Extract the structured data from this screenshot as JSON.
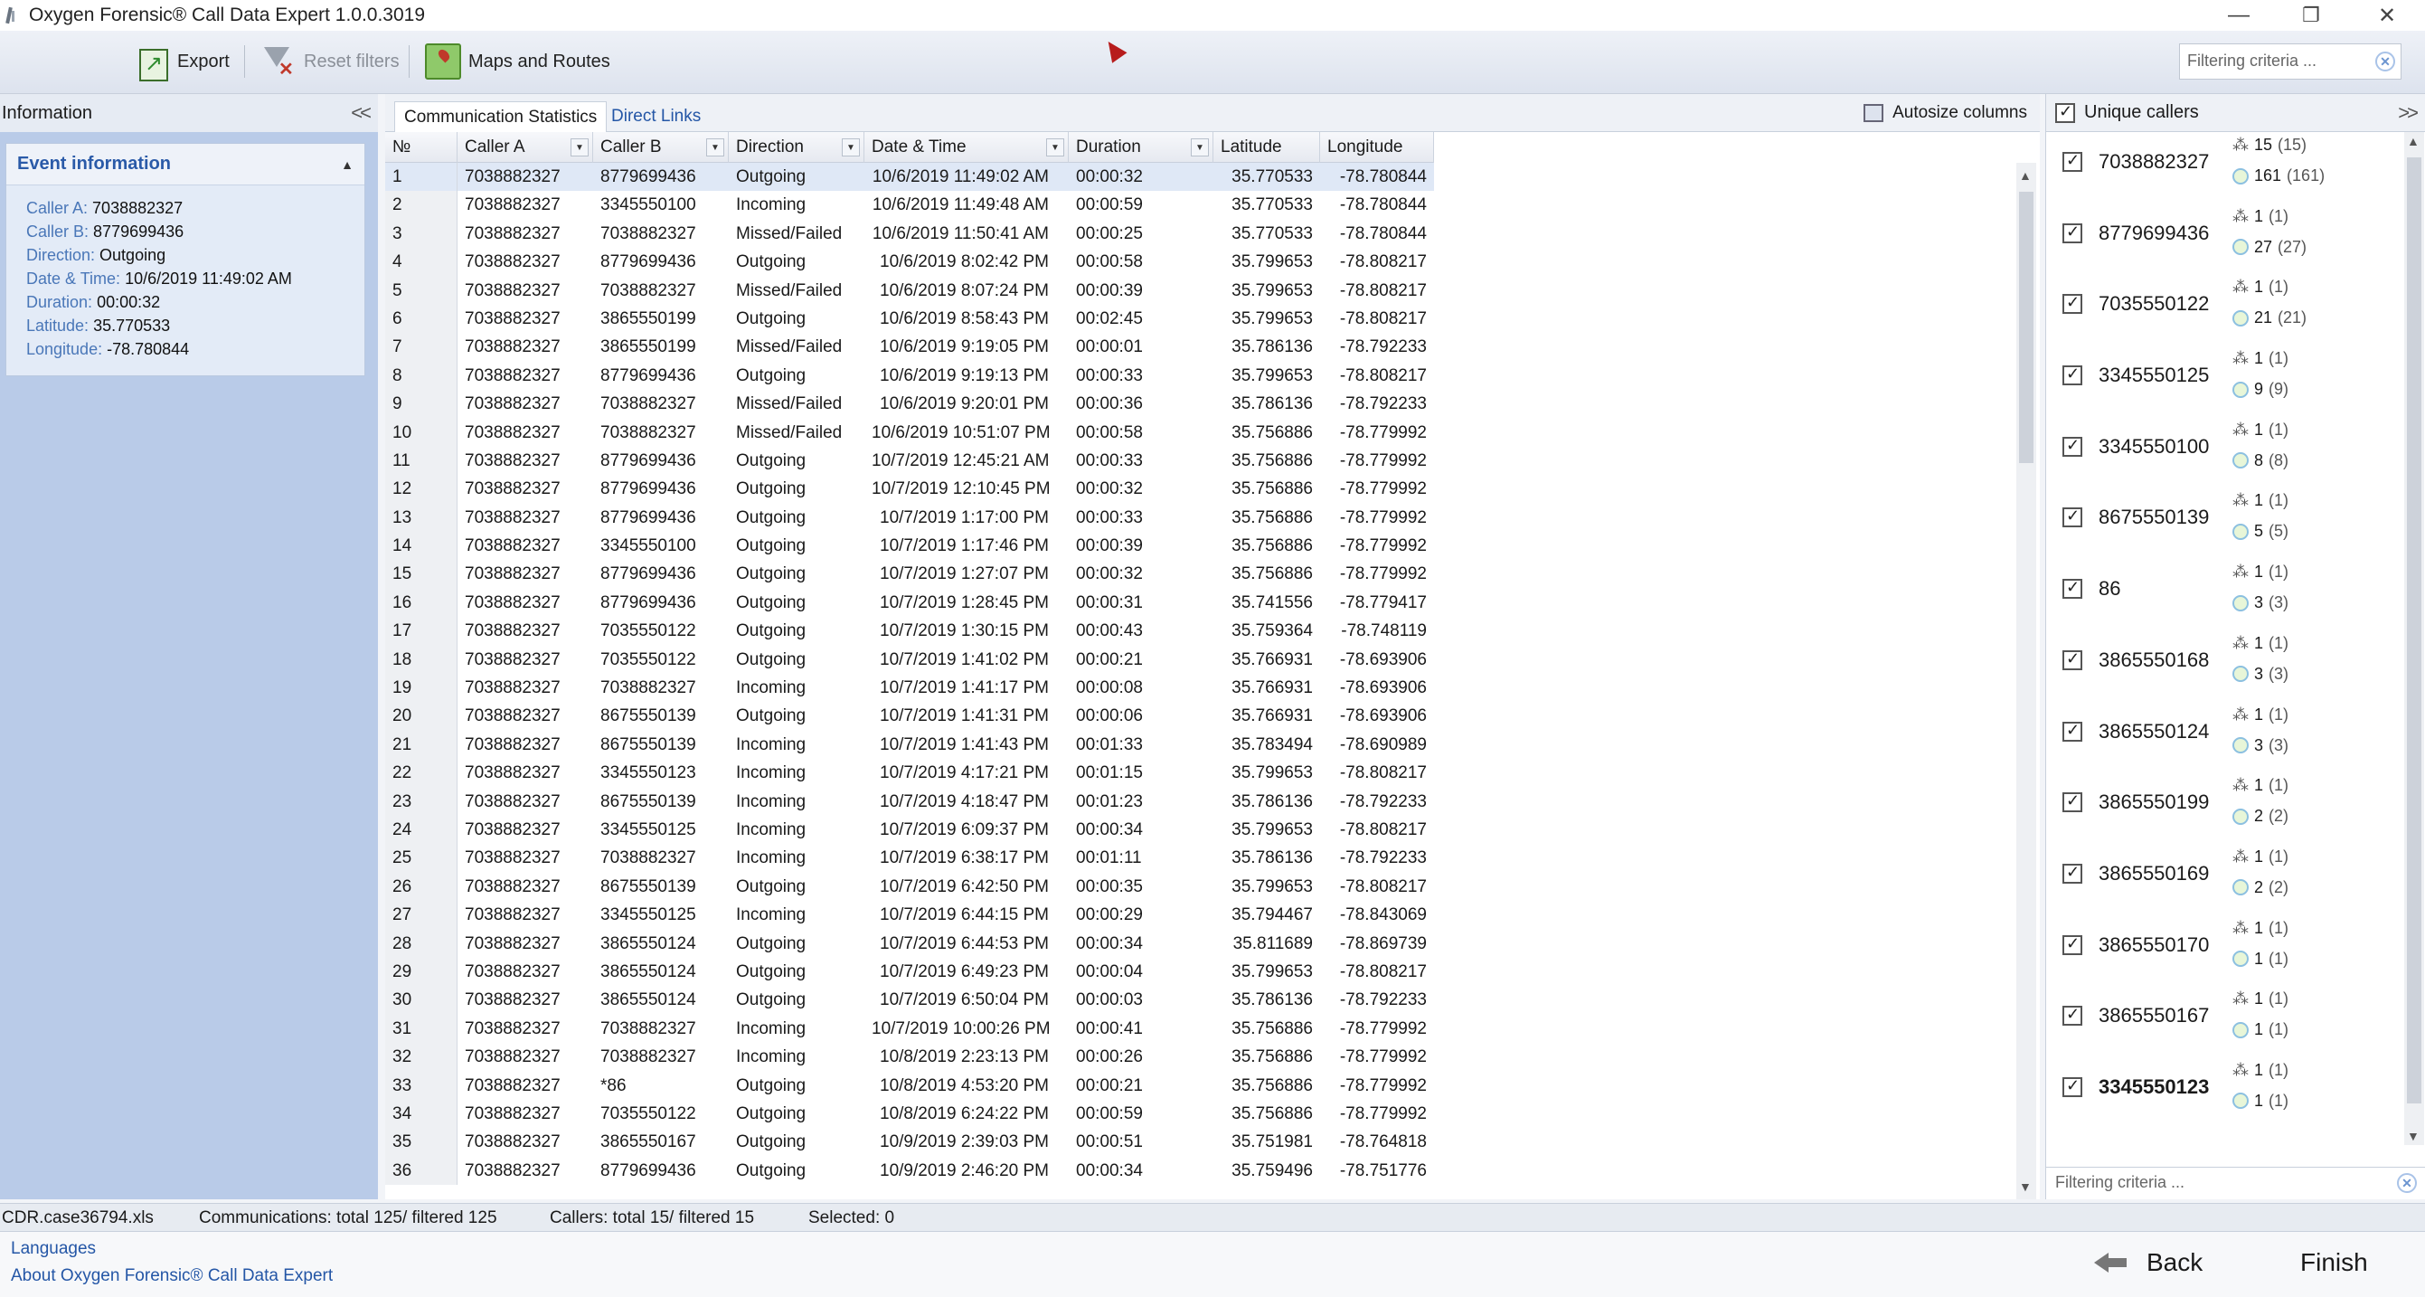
{
  "window": {
    "title": "Oxygen Forensic® Call Data Expert 1.0.0.3019",
    "minimize": "—",
    "restore": "❐",
    "close": "✕"
  },
  "toolbar": {
    "export_label": "Export",
    "reset_filters_label": "Reset filters",
    "maps_routes_label": "Maps and Routes",
    "filter_placeholder": "Filtering criteria ..."
  },
  "left_panel": {
    "header": "Information",
    "collapse": "<<",
    "event_title": "Event information",
    "event": [
      {
        "label": "Caller A:",
        "value": "7038882327"
      },
      {
        "label": "Caller B:",
        "value": "8779699436"
      },
      {
        "label": "Direction:",
        "value": "Outgoing"
      },
      {
        "label": "Date & Time:",
        "value": "10/6/2019 11:49:02 AM"
      },
      {
        "label": "Duration:",
        "value": "00:00:32"
      },
      {
        "label": "Latitude:",
        "value": "35.770533"
      },
      {
        "label": "Longitude:",
        "value": "-78.780844"
      }
    ]
  },
  "tabs": {
    "stats": "Communication Statistics",
    "links": "Direct Links",
    "autosize": "Autosize columns"
  },
  "grid": {
    "columns": [
      "№",
      "Caller A",
      "Caller B",
      "Direction",
      "Date & Time",
      "Duration",
      "Latitude",
      "Longitude"
    ],
    "rows": [
      [
        "1",
        "7038882327",
        "8779699436",
        "Outgoing",
        "10/6/2019 11:49:02 AM",
        "00:00:32",
        "35.770533",
        "-78.780844"
      ],
      [
        "2",
        "7038882327",
        "3345550100",
        "Incoming",
        "10/6/2019 11:49:48 AM",
        "00:00:59",
        "35.770533",
        "-78.780844"
      ],
      [
        "3",
        "7038882327",
        "7038882327",
        "Missed/Failed",
        "10/6/2019 11:50:41 AM",
        "00:00:25",
        "35.770533",
        "-78.780844"
      ],
      [
        "4",
        "7038882327",
        "8779699436",
        "Outgoing",
        "10/6/2019 8:02:42 PM",
        "00:00:58",
        "35.799653",
        "-78.808217"
      ],
      [
        "5",
        "7038882327",
        "7038882327",
        "Missed/Failed",
        "10/6/2019 8:07:24 PM",
        "00:00:39",
        "35.799653",
        "-78.808217"
      ],
      [
        "6",
        "7038882327",
        "3865550199",
        "Outgoing",
        "10/6/2019 8:58:43 PM",
        "00:02:45",
        "35.799653",
        "-78.808217"
      ],
      [
        "7",
        "7038882327",
        "3865550199",
        "Missed/Failed",
        "10/6/2019 9:19:05 PM",
        "00:00:01",
        "35.786136",
        "-78.792233"
      ],
      [
        "8",
        "7038882327",
        "8779699436",
        "Outgoing",
        "10/6/2019 9:19:13 PM",
        "00:00:33",
        "35.799653",
        "-78.808217"
      ],
      [
        "9",
        "7038882327",
        "7038882327",
        "Missed/Failed",
        "10/6/2019 9:20:01 PM",
        "00:00:36",
        "35.786136",
        "-78.792233"
      ],
      [
        "10",
        "7038882327",
        "7038882327",
        "Missed/Failed",
        "10/6/2019 10:51:07 PM",
        "00:00:58",
        "35.756886",
        "-78.779992"
      ],
      [
        "11",
        "7038882327",
        "8779699436",
        "Outgoing",
        "10/7/2019 12:45:21 AM",
        "00:00:33",
        "35.756886",
        "-78.779992"
      ],
      [
        "12",
        "7038882327",
        "8779699436",
        "Outgoing",
        "10/7/2019 12:10:45 PM",
        "00:00:32",
        "35.756886",
        "-78.779992"
      ],
      [
        "13",
        "7038882327",
        "8779699436",
        "Outgoing",
        "10/7/2019 1:17:00 PM",
        "00:00:33",
        "35.756886",
        "-78.779992"
      ],
      [
        "14",
        "7038882327",
        "3345550100",
        "Outgoing",
        "10/7/2019 1:17:46 PM",
        "00:00:39",
        "35.756886",
        "-78.779992"
      ],
      [
        "15",
        "7038882327",
        "8779699436",
        "Outgoing",
        "10/7/2019 1:27:07 PM",
        "00:00:32",
        "35.756886",
        "-78.779992"
      ],
      [
        "16",
        "7038882327",
        "8779699436",
        "Outgoing",
        "10/7/2019 1:28:45 PM",
        "00:00:31",
        "35.741556",
        "-78.779417"
      ],
      [
        "17",
        "7038882327",
        "7035550122",
        "Outgoing",
        "10/7/2019 1:30:15 PM",
        "00:00:43",
        "35.759364",
        "-78.748119"
      ],
      [
        "18",
        "7038882327",
        "7035550122",
        "Outgoing",
        "10/7/2019 1:41:02 PM",
        "00:00:21",
        "35.766931",
        "-78.693906"
      ],
      [
        "19",
        "7038882327",
        "7038882327",
        "Incoming",
        "10/7/2019 1:41:17 PM",
        "00:00:08",
        "35.766931",
        "-78.693906"
      ],
      [
        "20",
        "7038882327",
        "8675550139",
        "Outgoing",
        "10/7/2019 1:41:31 PM",
        "00:00:06",
        "35.766931",
        "-78.693906"
      ],
      [
        "21",
        "7038882327",
        "8675550139",
        "Incoming",
        "10/7/2019 1:41:43 PM",
        "00:01:33",
        "35.783494",
        "-78.690989"
      ],
      [
        "22",
        "7038882327",
        "3345550123",
        "Incoming",
        "10/7/2019 4:17:21 PM",
        "00:01:15",
        "35.799653",
        "-78.808217"
      ],
      [
        "23",
        "7038882327",
        "8675550139",
        "Incoming",
        "10/7/2019 4:18:47 PM",
        "00:01:23",
        "35.786136",
        "-78.792233"
      ],
      [
        "24",
        "7038882327",
        "3345550125",
        "Incoming",
        "10/7/2019 6:09:37 PM",
        "00:00:34",
        "35.799653",
        "-78.808217"
      ],
      [
        "25",
        "7038882327",
        "7038882327",
        "Incoming",
        "10/7/2019 6:38:17 PM",
        "00:01:11",
        "35.786136",
        "-78.792233"
      ],
      [
        "26",
        "7038882327",
        "8675550139",
        "Outgoing",
        "10/7/2019 6:42:50 PM",
        "00:00:35",
        "35.799653",
        "-78.808217"
      ],
      [
        "27",
        "7038882327",
        "3345550125",
        "Incoming",
        "10/7/2019 6:44:15 PM",
        "00:00:29",
        "35.794467",
        "-78.843069"
      ],
      [
        "28",
        "7038882327",
        "3865550124",
        "Outgoing",
        "10/7/2019 6:44:53 PM",
        "00:00:34",
        "35.811689",
        "-78.869739"
      ],
      [
        "29",
        "7038882327",
        "3865550124",
        "Outgoing",
        "10/7/2019 6:49:23 PM",
        "00:00:04",
        "35.799653",
        "-78.808217"
      ],
      [
        "30",
        "7038882327",
        "3865550124",
        "Outgoing",
        "10/7/2019 6:50:04 PM",
        "00:00:03",
        "35.786136",
        "-78.792233"
      ],
      [
        "31",
        "7038882327",
        "7038882327",
        "Incoming",
        "10/7/2019 10:00:26 PM",
        "00:00:41",
        "35.756886",
        "-78.779992"
      ],
      [
        "32",
        "7038882327",
        "7038882327",
        "Incoming",
        "10/8/2019 2:23:13 PM",
        "00:00:26",
        "35.756886",
        "-78.779992"
      ],
      [
        "33",
        "7038882327",
        "*86",
        "Outgoing",
        "10/8/2019 4:53:20 PM",
        "00:00:21",
        "35.756886",
        "-78.779992"
      ],
      [
        "34",
        "7038882327",
        "7035550122",
        "Outgoing",
        "10/8/2019 6:24:22 PM",
        "00:00:59",
        "35.756886",
        "-78.779992"
      ],
      [
        "35",
        "7038882327",
        "3865550167",
        "Outgoing",
        "10/9/2019 2:39:03 PM",
        "00:00:51",
        "35.751981",
        "-78.764818"
      ],
      [
        "36",
        "7038882327",
        "8779699436",
        "Outgoing",
        "10/9/2019 2:46:20 PM",
        "00:00:34",
        "35.759496",
        "-78.751776"
      ]
    ]
  },
  "right_panel": {
    "header": "Unique callers",
    "expand": ">>",
    "filter_placeholder": "Filtering criteria ...",
    "callers": [
      {
        "number": "7038882327",
        "s1": "15",
        "s1p": "(15)",
        "s2": "161",
        "s2p": "(161)"
      },
      {
        "number": "8779699436",
        "s1": "1",
        "s1p": "(1)",
        "s2": "27",
        "s2p": "(27)"
      },
      {
        "number": "7035550122",
        "s1": "1",
        "s1p": "(1)",
        "s2": "21",
        "s2p": "(21)"
      },
      {
        "number": "3345550125",
        "s1": "1",
        "s1p": "(1)",
        "s2": "9",
        "s2p": "(9)"
      },
      {
        "number": "3345550100",
        "s1": "1",
        "s1p": "(1)",
        "s2": "8",
        "s2p": "(8)"
      },
      {
        "number": "8675550139",
        "s1": "1",
        "s1p": "(1)",
        "s2": "5",
        "s2p": "(5)"
      },
      {
        "number": "86",
        "s1": "1",
        "s1p": "(1)",
        "s2": "3",
        "s2p": "(3)"
      },
      {
        "number": "3865550168",
        "s1": "1",
        "s1p": "(1)",
        "s2": "3",
        "s2p": "(3)"
      },
      {
        "number": "3865550124",
        "s1": "1",
        "s1p": "(1)",
        "s2": "3",
        "s2p": "(3)"
      },
      {
        "number": "3865550199",
        "s1": "1",
        "s1p": "(1)",
        "s2": "2",
        "s2p": "(2)"
      },
      {
        "number": "3865550169",
        "s1": "1",
        "s1p": "(1)",
        "s2": "2",
        "s2p": "(2)"
      },
      {
        "number": "3865550170",
        "s1": "1",
        "s1p": "(1)",
        "s2": "1",
        "s2p": "(1)"
      },
      {
        "number": "3865550167",
        "s1": "1",
        "s1p": "(1)",
        "s2": "1",
        "s2p": "(1)"
      },
      {
        "number": "3345550123",
        "s1": "1",
        "s1p": "(1)",
        "s2": "1",
        "s2p": "(1)"
      }
    ]
  },
  "status": {
    "file": "CDR.case36794.xls",
    "communications": "Communications: total 125/ filtered 125",
    "callers": "Callers: total 15/ filtered 15",
    "selected": "Selected: 0"
  },
  "bottom": {
    "languages": "Languages",
    "about": "About Oxygen Forensic® Call Data Expert",
    "back": "Back",
    "finish": "Finish"
  }
}
